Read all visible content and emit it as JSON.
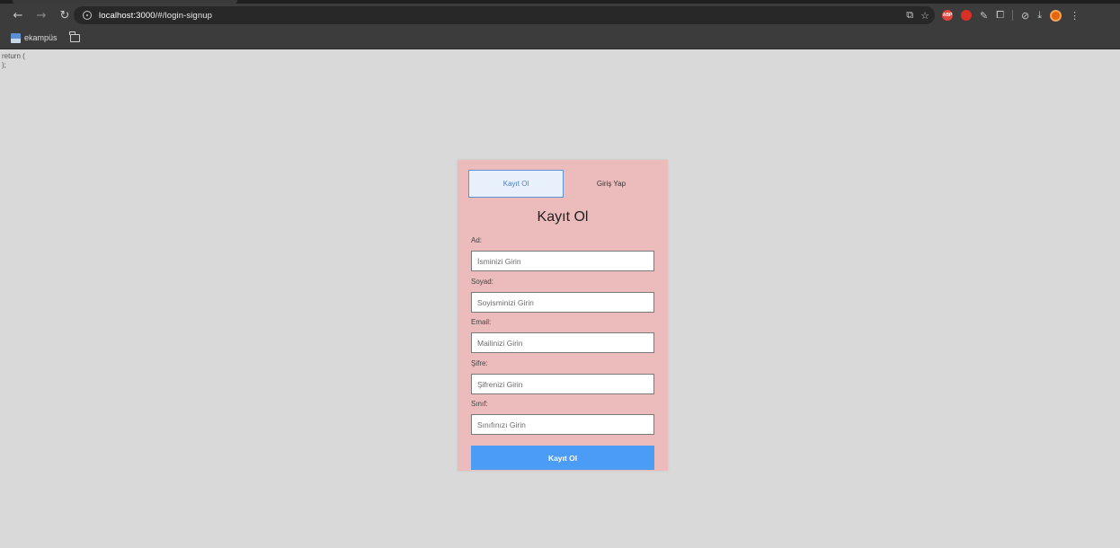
{
  "browser": {
    "url_host": "localhost:3000",
    "url_path": "/#/login-signup",
    "bookmarks": [
      {
        "label": "ekampüs"
      }
    ],
    "extensions": {
      "abp_label": "ABP",
      "profile_initial": "e"
    }
  },
  "page": {
    "code_line_1": "return (",
    "code_line_2": ");"
  },
  "form": {
    "tabs": [
      {
        "label": "Kayıt Ol",
        "active": true
      },
      {
        "label": "Giriş Yap",
        "active": false
      }
    ],
    "title": "Kayıt Ol",
    "fields": [
      {
        "label": "Ad:",
        "placeholder": "İsminizi Girin",
        "value": ""
      },
      {
        "label": "Soyad:",
        "placeholder": "Soyisminizi Girin",
        "value": ""
      },
      {
        "label": "Email:",
        "placeholder": "Mailinizi Girin",
        "value": ""
      },
      {
        "label": "Şifre:",
        "placeholder": "Şifrenizi Girin",
        "value": ""
      },
      {
        "label": "Sınıf:",
        "placeholder": "Sınıfınızı Girin",
        "value": ""
      }
    ],
    "submit_label": "Kayıt Ol"
  },
  "colors": {
    "card_bg": "#ebbcbb",
    "submit_bg": "#4a9cf5",
    "active_tab_border": "#5e93d4",
    "page_bg": "#d9d9d9"
  }
}
